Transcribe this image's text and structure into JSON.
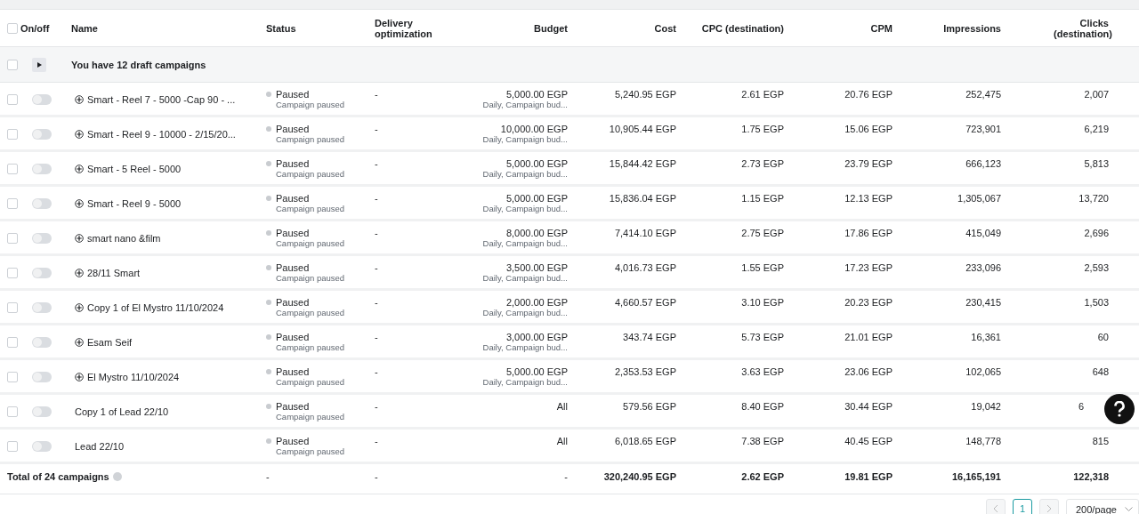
{
  "table": {
    "columns": [
      "On/off",
      "Name",
      "Status",
      "Delivery optimization",
      "Budget",
      "Cost",
      "CPC (destination)",
      "CPM",
      "Impressions",
      "Clicks (destination)"
    ],
    "select_all": {
      "checked": false
    },
    "draft_group": {
      "text": "You have 12 draft campaigns",
      "expanded": false,
      "checked": false
    },
    "rows": [
      {
        "checked": false,
        "on": false,
        "kind": "smart",
        "name": "Smart - Reel 7 - 5000 -Cap 90 - ...",
        "status": "Paused",
        "status_detail": "Campaign paused",
        "delivery": "-",
        "budget": "5,000.00 EGP",
        "budget_detail": "Daily, Campaign bud...",
        "cost": "5,240.95 EGP",
        "cpc": "2.61 EGP",
        "cpm": "20.76 EGP",
        "impressions": "252,475",
        "clicks": "2,007"
      },
      {
        "checked": false,
        "on": false,
        "kind": "smart",
        "name": "Smart - Reel 9 - 10000 - 2/15/20...",
        "status": "Paused",
        "status_detail": "Campaign paused",
        "delivery": "-",
        "budget": "10,000.00 EGP",
        "budget_detail": "Daily, Campaign bud...",
        "cost": "10,905.44 EGP",
        "cpc": "1.75 EGP",
        "cpm": "15.06 EGP",
        "impressions": "723,901",
        "clicks": "6,219"
      },
      {
        "checked": false,
        "on": false,
        "kind": "smart",
        "name": "Smart - 5 Reel - 5000",
        "status": "Paused",
        "status_detail": "Campaign paused",
        "delivery": "-",
        "budget": "5,000.00 EGP",
        "budget_detail": "Daily, Campaign bud...",
        "cost": "15,844.42 EGP",
        "cpc": "2.73 EGP",
        "cpm": "23.79 EGP",
        "impressions": "666,123",
        "clicks": "5,813"
      },
      {
        "checked": false,
        "on": false,
        "kind": "smart",
        "name": "Smart - Reel 9 - 5000",
        "status": "Paused",
        "status_detail": "Campaign paused",
        "delivery": "-",
        "budget": "5,000.00 EGP",
        "budget_detail": "Daily, Campaign bud...",
        "cost": "15,836.04 EGP",
        "cpc": "1.15 EGP",
        "cpm": "12.13 EGP",
        "impressions": "1,305,067",
        "clicks": "13,720"
      },
      {
        "checked": false,
        "on": false,
        "kind": "smart",
        "name": "smart nano &film",
        "status": "Paused",
        "status_detail": "Campaign paused",
        "delivery": "-",
        "budget": "8,000.00 EGP",
        "budget_detail": "Daily, Campaign bud...",
        "cost": "7,414.10 EGP",
        "cpc": "2.75 EGP",
        "cpm": "17.86 EGP",
        "impressions": "415,049",
        "clicks": "2,696"
      },
      {
        "checked": false,
        "on": false,
        "kind": "smart",
        "name": "28/11 Smart",
        "status": "Paused",
        "status_detail": "Campaign paused",
        "delivery": "-",
        "budget": "3,500.00 EGP",
        "budget_detail": "Daily, Campaign bud...",
        "cost": "4,016.73 EGP",
        "cpc": "1.55 EGP",
        "cpm": "17.23 EGP",
        "impressions": "233,096",
        "clicks": "2,593"
      },
      {
        "checked": false,
        "on": false,
        "kind": "smart",
        "name": "Copy 1 of El Mystro 11/10/2024",
        "status": "Paused",
        "status_detail": "Campaign paused",
        "delivery": "-",
        "budget": "2,000.00 EGP",
        "budget_detail": "Daily, Campaign bud...",
        "cost": "4,660.57 EGP",
        "cpc": "3.10 EGP",
        "cpm": "20.23 EGP",
        "impressions": "230,415",
        "clicks": "1,503"
      },
      {
        "checked": false,
        "on": false,
        "kind": "smart",
        "name": "Esam Seif",
        "status": "Paused",
        "status_detail": "Campaign paused",
        "delivery": "-",
        "budget": "3,000.00 EGP",
        "budget_detail": "Daily, Campaign bud...",
        "cost": "343.74 EGP",
        "cpc": "5.73 EGP",
        "cpm": "21.01 EGP",
        "impressions": "16,361",
        "clicks": "60"
      },
      {
        "checked": false,
        "on": false,
        "kind": "smart",
        "name": "El Mystro 11/10/2024",
        "status": "Paused",
        "status_detail": "Campaign paused",
        "delivery": "-",
        "budget": "5,000.00 EGP",
        "budget_detail": "Daily, Campaign bud...",
        "cost": "2,353.53 EGP",
        "cpc": "3.63 EGP",
        "cpm": "23.06 EGP",
        "impressions": "102,065",
        "clicks": "648"
      },
      {
        "checked": false,
        "on": false,
        "kind": "standard",
        "name": "Copy 1 of Lead 22/10",
        "status": "Paused",
        "status_detail": "Campaign paused",
        "delivery": "-",
        "budget": "All",
        "cost": "579.56 EGP",
        "cpc": "8.40 EGP",
        "cpm": "30.44 EGP",
        "impressions": "19,042",
        "clicks": "6"
      },
      {
        "checked": false,
        "on": false,
        "kind": "standard",
        "name": "Lead 22/10",
        "status": "Paused",
        "status_detail": "Campaign paused",
        "delivery": "-",
        "budget": "All",
        "cost": "6,018.65 EGP",
        "cpc": "7.38 EGP",
        "cpm": "40.45 EGP",
        "impressions": "148,778",
        "clicks": "815"
      }
    ],
    "total": {
      "label": "Total of 24 campaigns",
      "status": "-",
      "delivery": "-",
      "budget": "-",
      "cost": "320,240.95 EGP",
      "cpc": "2.62 EGP",
      "cpm": "19.81 EGP",
      "impressions": "16,165,191",
      "clicks": "122,318"
    }
  },
  "pagination": {
    "pages": [
      {
        "label": "1",
        "selected": true
      }
    ],
    "page_size": "200/page"
  }
}
